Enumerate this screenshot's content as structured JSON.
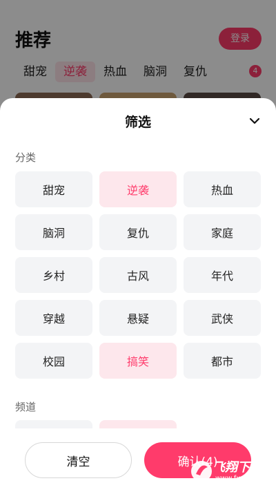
{
  "background": {
    "title": "推荐",
    "login_label": "登录",
    "tabs": [
      "甜宠",
      "逆袭",
      "热血",
      "脑洞",
      "复仇"
    ],
    "active_tab_index": 1,
    "badge": "4"
  },
  "sheet": {
    "title": "筛选",
    "category_label": "分类",
    "categories": [
      {
        "label": "甜宠",
        "selected": false
      },
      {
        "label": "逆袭",
        "selected": true
      },
      {
        "label": "热血",
        "selected": false
      },
      {
        "label": "脑洞",
        "selected": false
      },
      {
        "label": "复仇",
        "selected": false
      },
      {
        "label": "家庭",
        "selected": false
      },
      {
        "label": "乡村",
        "selected": false
      },
      {
        "label": "古风",
        "selected": false
      },
      {
        "label": "年代",
        "selected": false
      },
      {
        "label": "穿越",
        "selected": false
      },
      {
        "label": "悬疑",
        "selected": false
      },
      {
        "label": "武侠",
        "selected": false
      },
      {
        "label": "校园",
        "selected": false
      },
      {
        "label": "搞笑",
        "selected": true
      },
      {
        "label": "都市",
        "selected": false
      }
    ],
    "channel_label": "频道",
    "channels": [
      {
        "label": "",
        "selected": false
      },
      {
        "label": "",
        "selected": true
      }
    ]
  },
  "footer": {
    "clear_label": "清空",
    "confirm_label": "确认(4)"
  },
  "watermark": {
    "text": "飞翔下载",
    "url": "www.fxxz.com"
  },
  "colors": {
    "accent": "#ff3b6b",
    "accent_light": "#fde7ec",
    "chip_bg": "#f3f4f6"
  }
}
